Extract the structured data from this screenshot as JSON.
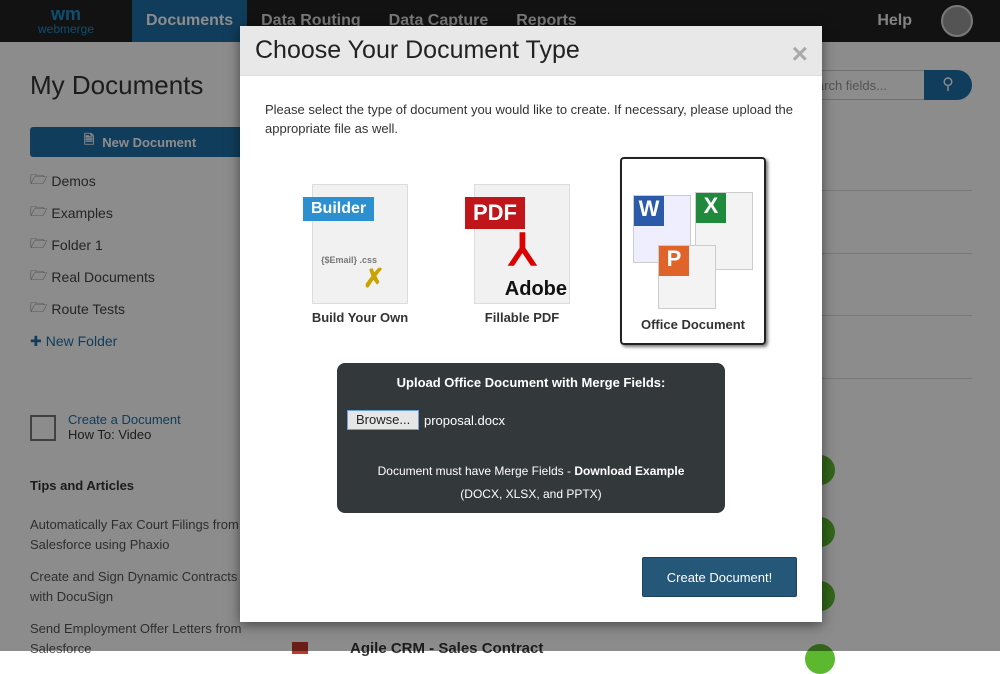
{
  "nav": {
    "logo_mark": "wm",
    "logo_text": "webmerge",
    "items": [
      "Documents",
      "Data Routing",
      "Data Capture",
      "Reports"
    ],
    "help": "Help"
  },
  "sidebar": {
    "title": "My Documents",
    "new_document": "New Document",
    "folders": [
      "Demos",
      "Examples",
      "Folder 1",
      "Real Documents",
      "Route Tests"
    ],
    "new_folder": "New Folder",
    "video_link": "Create a Document",
    "video_sub": "How To: Video",
    "tips_title": "Tips and Articles",
    "tips": [
      "Automatically Fax Court Filings from Salesforce using Phaxio",
      "Create and Sign Dynamic Contracts with DocuSign",
      "Send Employment Offer Letters from Salesforce"
    ]
  },
  "search": {
    "placeholder": "Search fields..."
  },
  "list": {
    "last_row": "Agile CRM - Sales Contract"
  },
  "modal": {
    "title": "Choose Your Document Type",
    "close": "×",
    "intro": "Please select the type of document you would like to create. If necessary, please upload the appropriate file as well.",
    "options": [
      {
        "label": "Build Your Own",
        "badge": "Builder"
      },
      {
        "label": "Fillable PDF",
        "badge": "PDF",
        "brand": "Adobe"
      },
      {
        "label": "Office Document",
        "selected": true
      }
    ],
    "upload": {
      "title": "Upload Office Document with Merge Fields:",
      "browse": "Browse...",
      "filename": "proposal.docx",
      "note": "Document must have Merge Fields - ",
      "note_link": "Download Example",
      "formats": "(DOCX, XLSX, and PPTX)"
    },
    "create": "Create Document!"
  },
  "colors": {
    "brand": "#1e6fa8",
    "button": "#255779",
    "panel": "#33383b"
  }
}
